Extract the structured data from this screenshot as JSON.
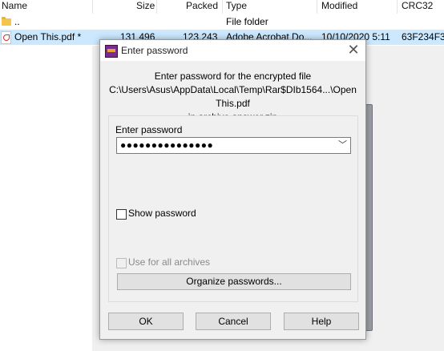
{
  "file_list": {
    "columns": [
      "Name",
      "Size",
      "Packed",
      "Type",
      "Modified",
      "CRC32"
    ],
    "rows": [
      {
        "name": "..",
        "size": "",
        "packed": "",
        "type": "File folder",
        "modified": "",
        "crc": ""
      },
      {
        "name": "Open This.pdf *",
        "size": "131,496",
        "packed": "123,243",
        "type": "Adobe Acrobat Do...",
        "modified": "10/10/2020 5:11",
        "crc": "63F234F3"
      }
    ]
  },
  "dialog": {
    "title": "Enter password",
    "close_glyph": "✕",
    "info_line1": "Enter password for the encrypted file",
    "info_line2": "C:\\Users\\Asus\\AppData\\Local\\Temp\\Rar$DIb1564...\\Open This.pdf",
    "info_line3": "in archive answer.zip",
    "password_label": "Enter password",
    "password_value": "●●●●●●●●●●●●●●●",
    "combo_arrow": "﹀",
    "show_password_label": "Show password",
    "use_all_label": "Use for all archives",
    "organize_label": "Organize passwords...",
    "ok_label": "OK",
    "cancel_label": "Cancel",
    "help_label": "Help"
  }
}
